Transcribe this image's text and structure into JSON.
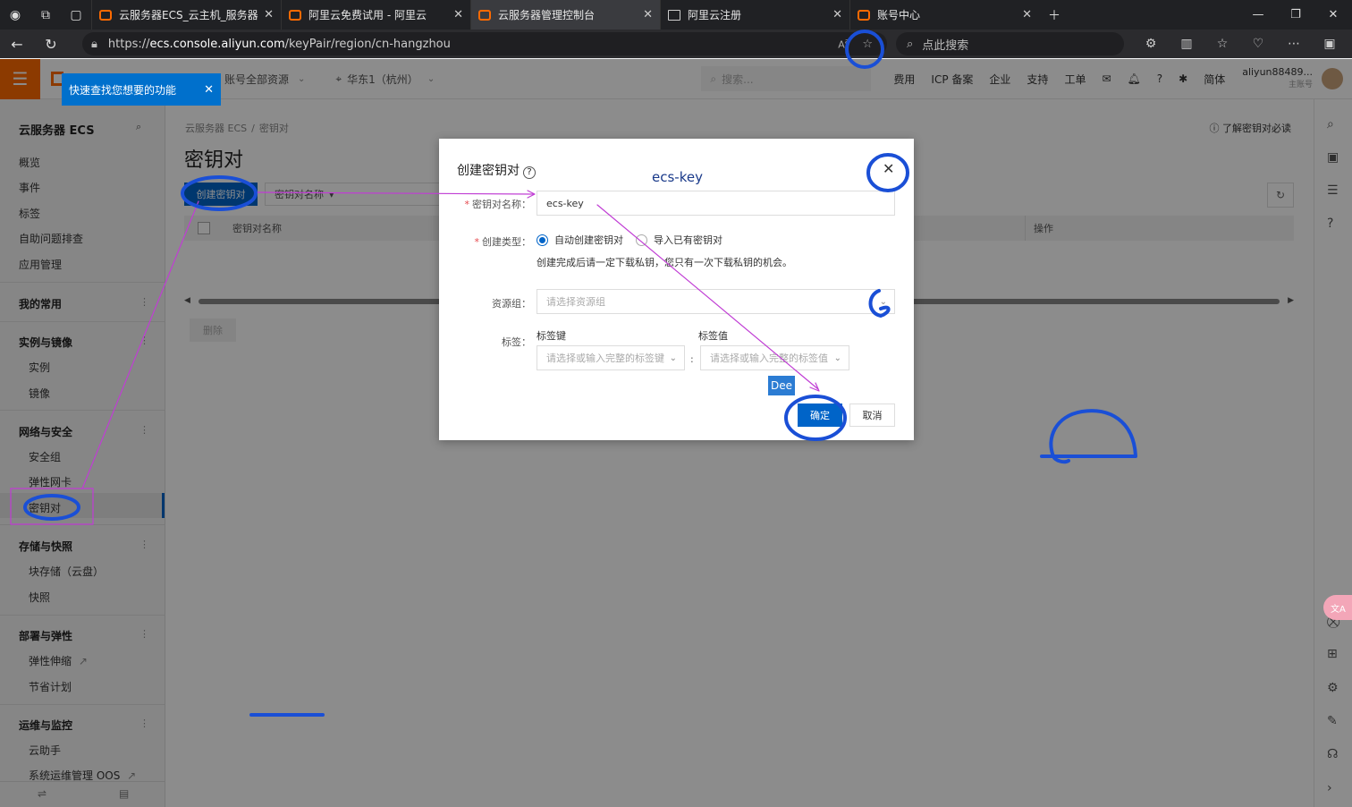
{
  "browser": {
    "tabs": [
      {
        "title": "云服务器ECS_云主机_服务器托管_",
        "active": false
      },
      {
        "title": "阿里云免费试用 - 阿里云",
        "active": false
      },
      {
        "title": "云服务器管理控制台",
        "active": true
      },
      {
        "title": "阿里云注册",
        "active": false
      },
      {
        "title": "账号中心",
        "active": false
      }
    ],
    "url_prefix": "https://",
    "url_host": "ecs.console.aliyun.com",
    "url_path": "/keyPair/region/cn-hangzhou",
    "search_placeholder": "点此搜索"
  },
  "header": {
    "tooltip": "快速查找您想要的功能",
    "resource_group": "账号全部资源",
    "region": "华东1（杭州）",
    "search_placeholder": "搜索...",
    "links": [
      "费用",
      "ICP 备案",
      "企业",
      "支持",
      "工单"
    ],
    "lang": "简体",
    "user_name": "aliyun88489...",
    "user_role": "主账号"
  },
  "sidebar": {
    "title": "云服务器 ECS",
    "top_items": [
      "概览",
      "事件",
      "标签",
      "自助问题排查",
      "应用管理"
    ],
    "groups": [
      {
        "title": "我的常用",
        "items": []
      },
      {
        "title": "实例与镜像",
        "items": [
          "实例",
          "镜像"
        ]
      },
      {
        "title": "网络与安全",
        "items": [
          "安全组",
          "弹性网卡",
          "密钥对"
        ]
      },
      {
        "title": "存储与快照",
        "items": [
          "块存储（云盘）",
          "快照"
        ]
      },
      {
        "title": "部署与弹性",
        "items": [
          "弹性伸缩",
          "节省计划"
        ]
      },
      {
        "title": "运维与监控",
        "items": [
          "云助手",
          "系统运维管理 OOS"
        ]
      }
    ],
    "active_item": "密钥对"
  },
  "main": {
    "breadcrumb": [
      "云服务器 ECS",
      "密钥对"
    ],
    "title": "密钥对",
    "help_link": "了解密钥对必读",
    "create_button": "创建密钥对",
    "filter_label": "密钥对名称",
    "columns": [
      "密钥对名称",
      "操作"
    ],
    "delete_button": "删除"
  },
  "modal": {
    "title": "创建密钥对",
    "name_label": "密钥对名称",
    "name_value": "ecs-key",
    "type_label": "创建类型",
    "type_options": [
      "自动创建密钥对",
      "导入已有密钥对"
    ],
    "type_selected": "自动创建密钥对",
    "type_hint": "创建完成后请一定下载私钥，您只有一次下载私钥的机会。",
    "resource_group_label": "资源组",
    "resource_group_placeholder": "请选择资源组",
    "tags_label": "标签",
    "tag_key_label": "标签键",
    "tag_key_placeholder": "请选择或输入完整的标签键",
    "tag_value_label": "标签值",
    "tag_value_placeholder": "请选择或输入完整的标签值",
    "ok_button": "确定",
    "cancel_button": "取消",
    "badge": "Dee"
  },
  "annotation": {
    "handwritten_text": "ecs-key",
    "ink_blue": "#1a4fd6",
    "ink_purple": "#c03dd4"
  },
  "colors": {
    "brand_orange": "#ff6a00",
    "primary_blue": "#0064c8"
  }
}
